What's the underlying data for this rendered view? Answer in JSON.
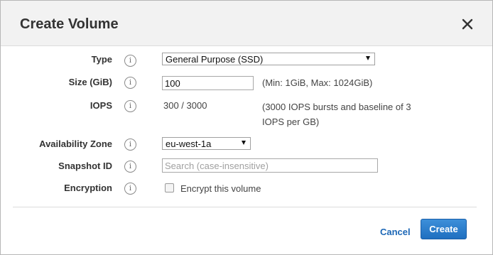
{
  "dialog": {
    "title": "Create Volume",
    "close_icon": "close-icon"
  },
  "form": {
    "type": {
      "label": "Type",
      "value": "General Purpose (SSD)"
    },
    "size": {
      "label": "Size (GiB)",
      "value": "100",
      "hint": "(Min: 1GiB, Max: 1024GiB)"
    },
    "iops": {
      "label": "IOPS",
      "value": "300 / 3000",
      "hint_line1": "(3000 IOPS bursts and baseline of 3",
      "hint_line2": "IOPS per GB)"
    },
    "availability_zone": {
      "label": "Availability Zone",
      "value": "eu-west-1a"
    },
    "snapshot_id": {
      "label": "Snapshot ID",
      "value": "",
      "placeholder": "Search (case-insensitive)"
    },
    "encryption": {
      "label": "Encryption",
      "checkbox_label": "Encrypt this volume",
      "checked": false
    },
    "info_icon": "i"
  },
  "footer": {
    "cancel_label": "Cancel",
    "create_label": "Create"
  },
  "colors": {
    "accent": "#1f6fc0",
    "link": "#1c67b6"
  }
}
